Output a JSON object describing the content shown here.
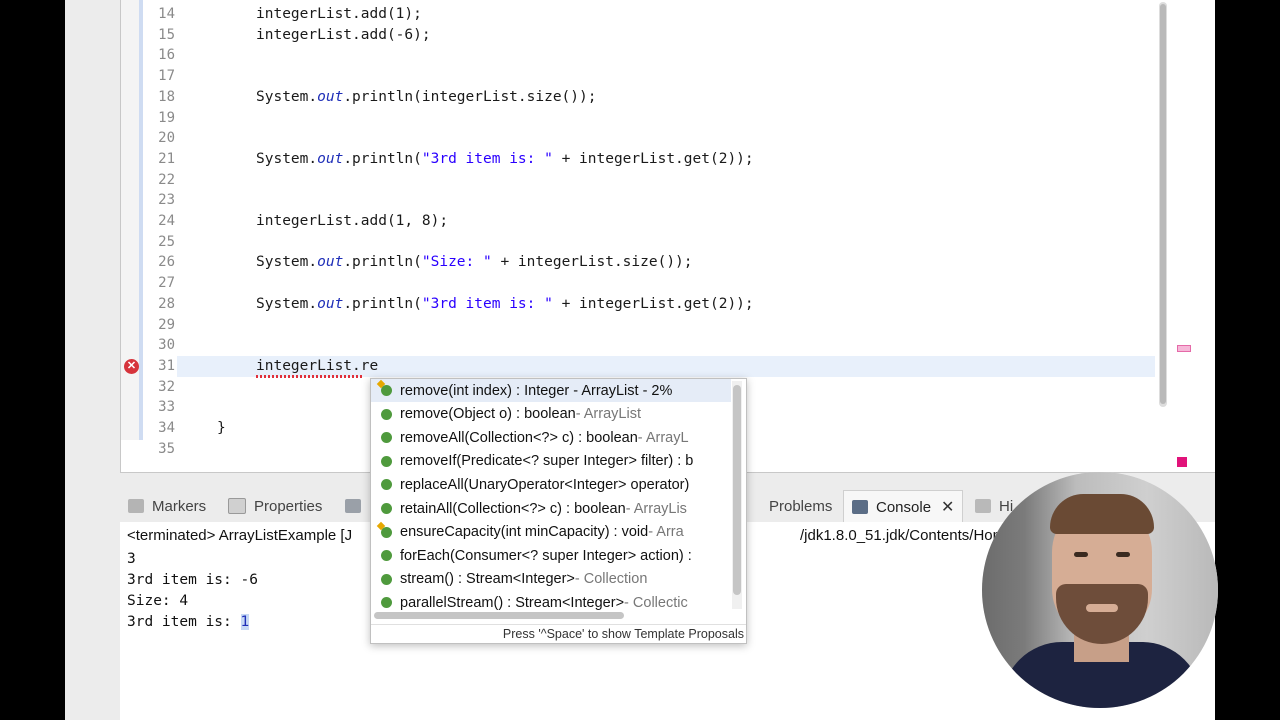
{
  "editor": {
    "line_numbers": [
      "14",
      "15",
      "16",
      "17",
      "18",
      "19",
      "20",
      "21",
      "22",
      "23",
      "24",
      "25",
      "26",
      "27",
      "28",
      "29",
      "30",
      "31",
      "32",
      "33",
      "34",
      "35"
    ],
    "lines": [
      {
        "plain": "integerList.add(1);"
      },
      {
        "plain": "integerList.add(-6);"
      },
      {
        "plain": ""
      },
      {
        "plain": ""
      },
      {
        "pre": "System.",
        "field": "out",
        "post": ".println(integerList.size());"
      },
      {
        "plain": ""
      },
      {
        "plain": ""
      },
      {
        "pre": "System.",
        "field": "out",
        "post": ".println(",
        "str": "\"3rd item is: \"",
        "tail": " + integerList.get(2));"
      },
      {
        "plain": ""
      },
      {
        "plain": ""
      },
      {
        "plain": "integerList.add(1, 8);"
      },
      {
        "plain": ""
      },
      {
        "pre": "System.",
        "field": "out",
        "post": ".println(",
        "str": "\"Size: \"",
        "tail": " + integerList.size());"
      },
      {
        "plain": ""
      },
      {
        "pre": "System.",
        "field": "out",
        "post": ".println(",
        "str": "\"3rd item is: \"",
        "tail": " + integerList.get(2));"
      },
      {
        "plain": ""
      },
      {
        "plain": ""
      },
      {
        "plain": "integerList.re"
      },
      {
        "plain": ""
      },
      {
        "plain": ""
      },
      {
        "plain": "}"
      },
      {
        "plain": ""
      }
    ],
    "error_icon": "error-x-icon"
  },
  "bottom_tabs": {
    "markers": "Markers",
    "properties": "Properties",
    "problems": "Problems",
    "console": "Console",
    "history": "Hi"
  },
  "console": {
    "terminated_prefix": "<terminated> ArrayListExample [J",
    "terminated_suffix": "/jdk1.8.0_51.jdk/Contents/Home/b",
    "output": [
      "3",
      "3rd item is: -6",
      "Size: 4",
      "3rd item is: "
    ],
    "last_value": "1"
  },
  "autocomplete": {
    "items": [
      {
        "main": "remove(int index) : Integer - ArrayList - 2%",
        "meta": "",
        "star": true
      },
      {
        "main": "remove(Object o) : boolean",
        "meta": " - ArrayList",
        "star": false
      },
      {
        "main": "removeAll(Collection<?> c) : boolean",
        "meta": " - ArrayL",
        "star": false
      },
      {
        "main": "removeIf(Predicate<? super Integer> filter) : b",
        "meta": "",
        "star": false
      },
      {
        "main": "replaceAll(UnaryOperator<Integer> operator)",
        "meta": "",
        "star": false
      },
      {
        "main": "retainAll(Collection<?> c) : boolean",
        "meta": " - ArrayLis",
        "star": false
      },
      {
        "main": "ensureCapacity(int minCapacity) : void",
        "meta": " - Arra",
        "star": true
      },
      {
        "main": "forEach(Consumer<? super Integer> action) :",
        "meta": "",
        "star": false
      },
      {
        "main": "stream() : Stream<Integer>",
        "meta": " - Collection",
        "star": false
      },
      {
        "main": "parallelStream() : Stream<Integer>",
        "meta": " - Collectic",
        "star": false
      }
    ],
    "footer": "Press '^Space' to show Template Proposals"
  }
}
